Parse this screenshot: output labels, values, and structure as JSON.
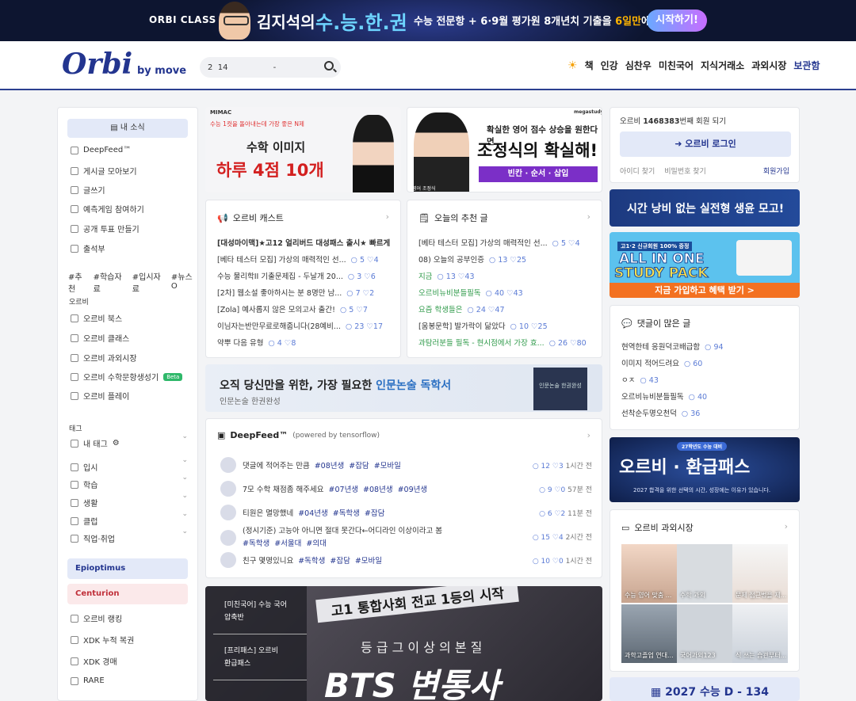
{
  "banner": {
    "brand": "ORBI CLASS",
    "name": "김지석의",
    "book": "수.능.한.권",
    "desc_a": "수능 전문항 + 6·9월 평가원 8개년치 기출을 ",
    "desc_b": "6일만",
    "desc_c": "에 완성!",
    "cta": "시작하기!"
  },
  "header": {
    "logo": "Orbi",
    "logo_sub": "by move",
    "search_value": "2  14                  -",
    "nav": [
      "책",
      "인강",
      "심찬우",
      "미친국어",
      "지식거래소",
      "과외시장",
      "보관함"
    ]
  },
  "left": {
    "my_sub": "내 소식",
    "menu": [
      "DeepFeed™",
      "게시글 모아보기",
      "글쓰기",
      "예측게임 참여하기",
      "공개 투표 만들기",
      "출석부"
    ],
    "tags": [
      "#추천",
      "#학습자료",
      "#입시자료",
      "#뉴스O"
    ],
    "orbi_label": "오르비",
    "orbi_menu": [
      "오르비 북스",
      "오르비 클래스",
      "오르비 과외시장",
      "오르비 수학문항생성기",
      "오르비 플레이"
    ],
    "beta": "Beta",
    "tag_label": "태그",
    "my_tag": "내 태그",
    "tag_items": [
      "입시",
      "학습",
      "생활",
      "클럽",
      "직업·취업"
    ],
    "tiers": [
      "Epioptimus",
      "Centurion"
    ],
    "bottom_menu": [
      "오르비 랭킹",
      "XDK 누적 복권",
      "XDK 경매",
      "RARE"
    ]
  },
  "ads": {
    "ad1_top": "수능 1컷을 돌아내는데 가장 좋은 N제",
    "ad1_a": "수학 이미지",
    "ad1_b": "하루 4점 10개",
    "ad1_brand": "MIMAC",
    "ad2_top": "확실한 영어 점수 상승을 원한다면",
    "ad2_a": "조정식의 확실해!",
    "ad2_b": "빈칸 · 순서 · 삽입",
    "ad2_brand": "megastudy",
    "ad2_name": "영어 조정식",
    "mid_a": "오직 당신만을 위한, 가장 필요한 ",
    "mid_b": "인문논술 독학서",
    "mid_sub": "인문논술 한권완성",
    "mid_book": "인문논술 한권완성",
    "r1": "시간 낭비 없는 실전형 생윤 모고!",
    "r2_top": "고1·2 신규회원 100% 증정",
    "r2_a": "ALL IN ONE",
    "r2_b": "STUDY PACK",
    "r2_c": "지금 가입하고 혜택 받기 >",
    "r3_badge": "27학년도 수능 대비",
    "r3_a": "오르비 · 환급패스",
    "r3_b": "2027 합격을 위한 선택의 시간, 성장에는 이유가 있습니다.",
    "bottom_a": "[미친국어] 수능 국어",
    "bottom_b": "압축반",
    "bottom_c": "[프리패스] 오르비",
    "bottom_d": "환급패스",
    "bottom_e": "등 급 그 이 상 의 본 질",
    "bottom_f": "BTS 변통사",
    "bottom_g": "고1 통합사회 전교 1등의 시작"
  },
  "cast": {
    "title": "오르비 캐스트",
    "rows": [
      {
        "t": "[대성마이맥]★고12 얼리버드 대성패스 출시★ 빠르게 ...",
        "c": "",
        "h": ""
      },
      {
        "t": "[베타 테스터 모집] 가상의 매력적인 선...",
        "c": "5",
        "h": "4"
      },
      {
        "t": "수능 물리학II 기출문제집 - 두날개 20...",
        "c": "3",
        "h": "6"
      },
      {
        "t": "[2차] 웹소설 좋아하시는 분 8명만 남...",
        "c": "7",
        "h": "2"
      },
      {
        "t": "[Zola] 예사롭지 않은 모의고사 출간!",
        "c": "5",
        "h": "7"
      },
      {
        "t": "이님자는반만무료로해줍니다(28예비...",
        "c": "23",
        "h": "17"
      },
      {
        "t": "약뿌 다음 유형",
        "c": "4",
        "h": "8"
      }
    ]
  },
  "recommend": {
    "title": "오늘의 추천 글",
    "rows": [
      {
        "t": "[베타 테스터 모집] 가상의 매력적인 선...",
        "c": "5",
        "h": "4",
        "g": false
      },
      {
        "t": "08) 오늘의 공부인증",
        "c": "13",
        "h": "25",
        "g": false
      },
      {
        "t": "지금",
        "c": "13",
        "h": "43",
        "g": true
      },
      {
        "t": "오르비뉴비분들필독",
        "c": "40",
        "h": "43",
        "g": true
      },
      {
        "t": "요즘 학생들은",
        "c": "24",
        "h": "47",
        "g": true
      },
      {
        "t": "[움봉문학] 발가락이 닮았다",
        "c": "10",
        "h": "25",
        "g": false
      },
      {
        "t": "과탐러분들 필독 - 현시점에서 가장 효...",
        "c": "26",
        "h": "80",
        "g": true
      }
    ]
  },
  "deepfeed": {
    "title": "DeepFeed™",
    "powered": "(powered by tensorflow)",
    "rows": [
      {
        "t": "댓글에 적어주는 만큼",
        "tags": [
          "#08년생",
          "#잡담",
          "#모바일"
        ],
        "c": "12",
        "h": "3",
        "time": "1시간 전"
      },
      {
        "t": "7모 수학 채점좀 해주세요",
        "tags": [
          "#07년생",
          "#08년생",
          "#09년생"
        ],
        "c": "9",
        "h": "0",
        "time": "57분 전"
      },
      {
        "t": "티원은 멸망했네",
        "tags": [
          "#04년생",
          "#독학생",
          "#잡담"
        ],
        "c": "6",
        "h": "2",
        "time": "11분 전"
      },
      {
        "t": "(정시기준) 고능아 아니면 절대 못간다←어디라인 이상이라고 봄",
        "tags": [
          "#독학생",
          "#서울대",
          "#의대"
        ],
        "c": "15",
        "h": "4",
        "time": "2시간 전"
      },
      {
        "t": "친구 몇명있니요",
        "tags": [
          "#독학생",
          "#잡담",
          "#모바일"
        ],
        "c": "10",
        "h": "0",
        "time": "1시간 전"
      }
    ]
  },
  "login": {
    "member_a": "오르비 ",
    "member_num": "1468383",
    "member_b": "번째 회원 되기",
    "btn": "오르비 로그인",
    "find_id": "아이디 찾기",
    "find_pw": "비밀번호 찾기",
    "join": "회원가입"
  },
  "most": {
    "title": "댓글이 많은 글",
    "rows": [
      {
        "t": "현역한테 응원덕코배급함",
        "c": "94"
      },
      {
        "t": "이미지 적어드려요",
        "c": "60"
      },
      {
        "t": "ㅇㅈ",
        "c": "43"
      },
      {
        "t": "오르비뉴비분들필독",
        "c": "40"
      },
      {
        "t": "선착순두명오천덕",
        "c": "36"
      }
    ]
  },
  "tutor": {
    "title": "오르비 과외시장",
    "items": [
      "수능 영어 맞춤 ...",
      "수학 과외",
      "문제 접근법을 제...",
      "과학고졸업 연대...",
      "국어과외123",
      "식 쓰는 습관부터..."
    ]
  },
  "dday": {
    "text": "2027 수능 D - 134"
  },
  "colors": {
    "brand": "#23358f",
    "accent": "#5b7bd5",
    "green": "#2f9a4a"
  }
}
